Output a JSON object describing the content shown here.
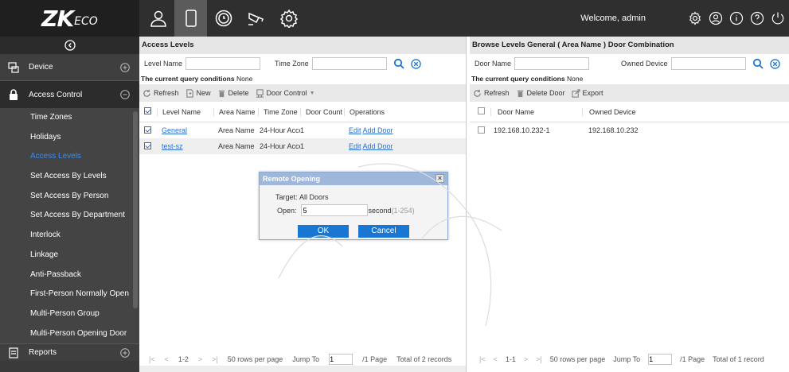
{
  "header": {
    "logo_main": "ZK",
    "logo_sub": "ECO",
    "welcome": "Welcome, admin"
  },
  "sidebar": {
    "device": "Device",
    "access_control": "Access Control",
    "items": [
      {
        "label": "Time Zones"
      },
      {
        "label": "Holidays"
      },
      {
        "label": "Access Levels",
        "active": true
      },
      {
        "label": "Set Access By Levels"
      },
      {
        "label": "Set Access By Person"
      },
      {
        "label": "Set Access By Department"
      },
      {
        "label": "Interlock"
      },
      {
        "label": "Linkage"
      },
      {
        "label": "Anti-Passback"
      },
      {
        "label": "First-Person Normally Open"
      },
      {
        "label": "Multi-Person Group"
      },
      {
        "label": "Multi-Person Opening Door"
      }
    ],
    "reports": "Reports"
  },
  "left": {
    "title": "Access Levels",
    "level_name_label": "Level Name",
    "time_zone_label": "Time Zone",
    "query_label": "The current query conditions",
    "query_value": "None",
    "toolbar": {
      "refresh": "Refresh",
      "new": "New",
      "delete": "Delete",
      "door_control": "Door Control"
    },
    "columns": [
      "Level Name",
      "Area Name",
      "Time Zone",
      "Door Count",
      "Operations"
    ],
    "rows": [
      {
        "level": "General",
        "area": "Area Name",
        "tz": "24-Hour Acce:",
        "count": "1",
        "edit": "Edit",
        "add": "Add Door"
      },
      {
        "level": "test-sz",
        "area": "Area Name",
        "tz": "24-Hour Acce:",
        "count": "1",
        "edit": "Edit",
        "add": "Add Door"
      }
    ],
    "pager": {
      "range": "1-2",
      "per_page": "50 rows per page",
      "jump": "Jump To",
      "page_input": "1",
      "page_of": "/1 Page",
      "total": "Total of 2 records"
    }
  },
  "right": {
    "title": "Browse Levels General ( Area Name ) Door Combination",
    "door_name_label": "Door Name",
    "owned_device_label": "Owned Device",
    "query_label": "The current query conditions",
    "query_value": "None",
    "toolbar": {
      "refresh": "Refresh",
      "delete_door": "Delete Door",
      "export": "Export"
    },
    "columns": [
      "Door Name",
      "Owned Device"
    ],
    "rows": [
      {
        "door": "192.168.10.232-1",
        "device": "192.168.10.232"
      }
    ],
    "pager": {
      "range": "1-1",
      "per_page": "50 rows per page",
      "jump": "Jump To",
      "page_input": "1",
      "page_of": "/1 Page",
      "total": "Total of 1 record"
    }
  },
  "dialog": {
    "title": "Remote Opening",
    "target_label": "Target:",
    "target_value": "All Doors",
    "open_label": "Open:",
    "open_value": "5",
    "unit": "second",
    "range": "(1-254)",
    "ok": "OK",
    "cancel": "Cancel"
  },
  "colors": {
    "accent": "#1976d2",
    "sidebar": "#3a3a3a",
    "topbar": "#2f2f2f",
    "link": "#2a6fd0"
  }
}
